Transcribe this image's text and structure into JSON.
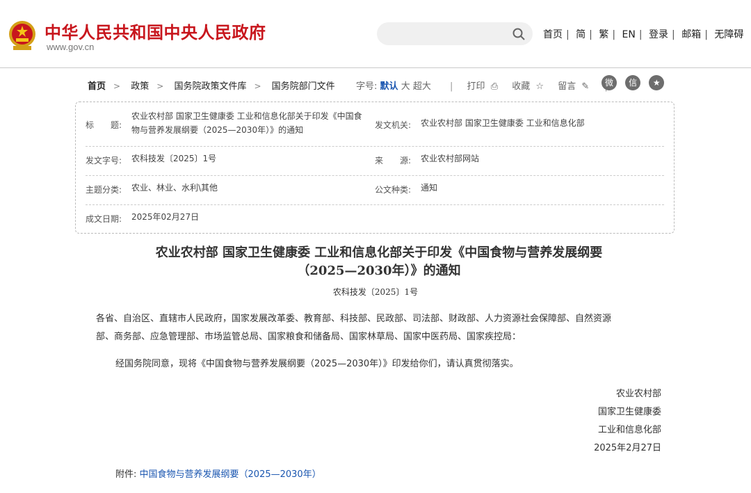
{
  "header": {
    "site_title": "中华人民共和国中央人民政府",
    "site_domain": "www.gov.cn",
    "search_placeholder": "",
    "nav": [
      "首页",
      "简",
      "繁",
      "EN",
      "登录",
      "邮箱",
      "无障碍"
    ],
    "brand_color": "#c8161d"
  },
  "toolbar": {
    "breadcrumbs": [
      "首页",
      "政策",
      "国务院政策文件库",
      "国务院部门文件"
    ],
    "font_label": "字号:",
    "font_options": [
      "默认",
      "大",
      "超大"
    ],
    "font_selected": "默认",
    "print": "打印",
    "favorite": "收藏",
    "comment": "留言",
    "share_icons": [
      "weibo-icon",
      "wechat-icon",
      "qzone-icon"
    ]
  },
  "info": {
    "title_label": "标　　题:",
    "title_value_1": "农业农村部 国家卫生健康委 工业和信息化部关于印发《中国食",
    "title_value_2": "物与营养发展纲要（2025—2030年）》的通知",
    "issuer_label": "发文机关:",
    "issuer_value": "农业农村部 国家卫生健康委 工业和信息化部",
    "docno_label": "发文字号:",
    "docno_value": "农科技发〔2025〕1号",
    "source_label": "来　　源:",
    "source_value": "农业农村部网站",
    "topic_label": "主题分类:",
    "topic_value": "农业、林业、水利\\其他",
    "type_label": "公文种类:",
    "type_value": "通知",
    "date_label": "成文日期:",
    "date_value": "2025年02月27日"
  },
  "article": {
    "title_line1": "农业农村部 国家卫生健康委 工业和信息化部关于印发《中国食物与营养发展纲要",
    "title_line2": "（2025—2030年）》的通知",
    "doc_no": "农科技发〔2025〕1号",
    "recipients_1": "各省、自治区、直辖市人民政府，国家发展改革委、教育部、科技部、民政部、司法部、财政部、人力资源社会保障部、自然资源",
    "recipients_2": "部、商务部、应急管理部、市场监管总局、国家粮食和储备局、国家林草局、国家中医药局、国家疾控局：",
    "body": "经国务院同意，现将《中国食物与营养发展纲要（2025—2030年）》印发给你们，请认真贯彻落实。",
    "signers": [
      "农业农村部",
      "国家卫生健康委",
      "工业和信息化部"
    ],
    "sign_date": "2025年2月27日",
    "attach_label": "附件:",
    "attach_link": "中国食物与营养发展纲要（2025—2030年）"
  }
}
